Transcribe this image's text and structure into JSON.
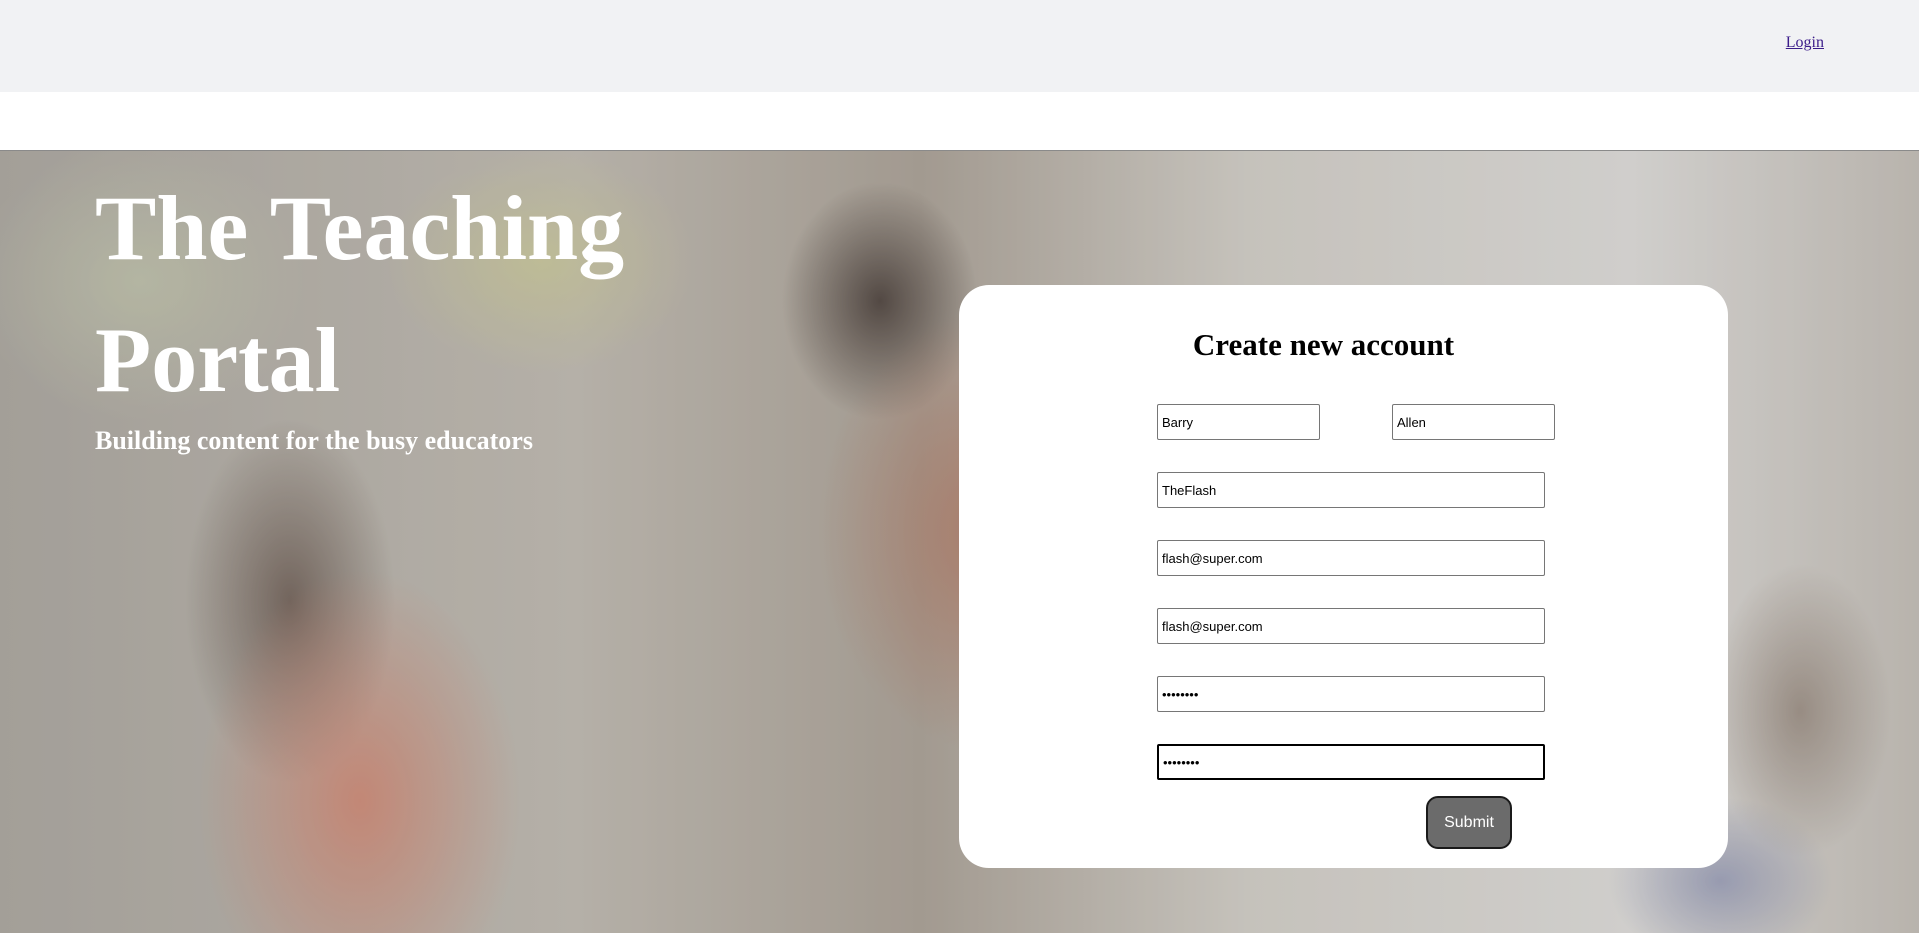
{
  "header": {
    "login_label": "Login"
  },
  "hero": {
    "title": "The Teaching Portal",
    "subtitle": "Building content for the busy educators",
    "background_image": "classroom-photo"
  },
  "form": {
    "title": "Create new account",
    "first_name": "Barry",
    "last_name": "Allen",
    "username": "TheFlash",
    "email": "flash@super.com",
    "email_confirm": "flash@super.com",
    "password": "••••••••",
    "password_confirm": "••••••••",
    "submit_label": "Submit"
  },
  "colors": {
    "topbar": "#f1f2f4",
    "link": "#3b1c8a",
    "submit_bg": "#6b6b6b",
    "card_bg": "#ffffff"
  }
}
